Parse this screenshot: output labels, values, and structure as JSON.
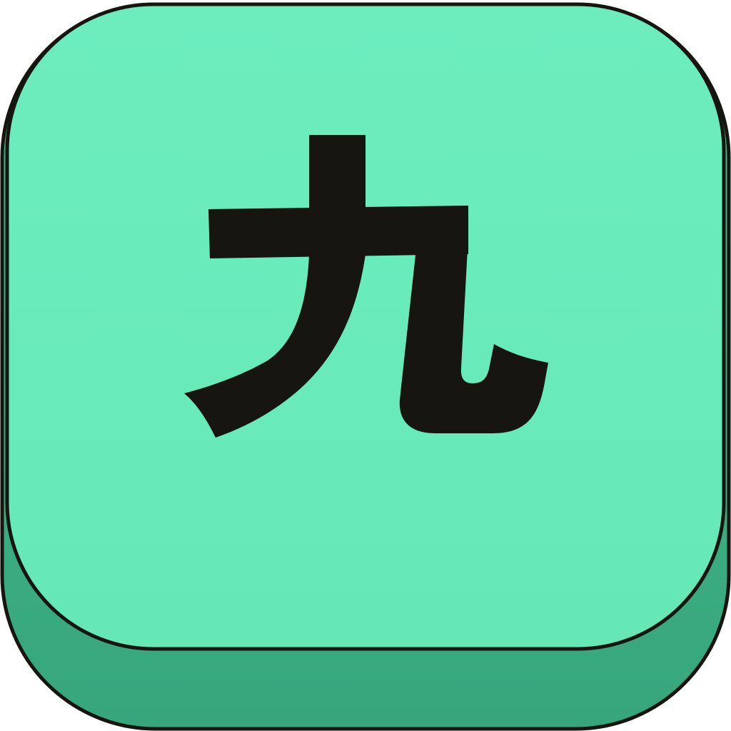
{
  "icon": {
    "glyph": "九",
    "glyph_name": "kanji-nine-icon",
    "colors": {
      "face": "#66E8B6",
      "face_top_highlight": "#6DEDBE",
      "side_light": "#46BA8E",
      "side_dark": "#37A67C",
      "outline": "#16150F",
      "glyph": "#16150F"
    }
  }
}
